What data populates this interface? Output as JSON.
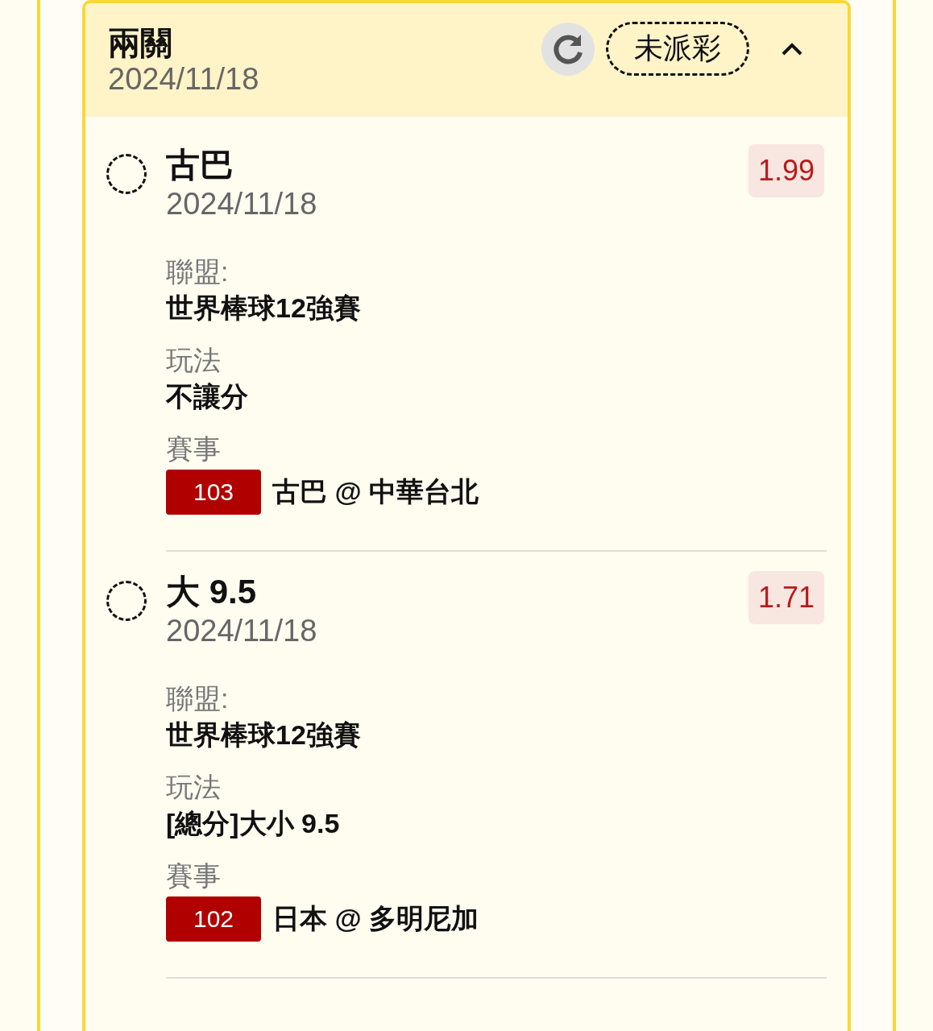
{
  "bet": {
    "title": "兩關",
    "date": "2024/11/18",
    "status": "未派彩",
    "expanded": true
  },
  "legs": [
    {
      "selected": false,
      "pick": "古巴",
      "date": "2024/11/18",
      "odds": "1.99",
      "league_label": "聯盟:",
      "league": "世界棒球12強賽",
      "market_label": "玩法",
      "market": "不讓分",
      "event_label": "賽事",
      "event_no": "103",
      "event": "古巴 @ 中華台北"
    },
    {
      "selected": false,
      "pick": "大 9.5",
      "date": "2024/11/18",
      "odds": "1.71",
      "league_label": "聯盟:",
      "league": "世界棒球12強賽",
      "market_label": "玩法",
      "market": "[總分]大小 9.5",
      "event_label": "賽事",
      "event_no": "102",
      "event": "日本 @ 多明尼加"
    }
  ]
}
